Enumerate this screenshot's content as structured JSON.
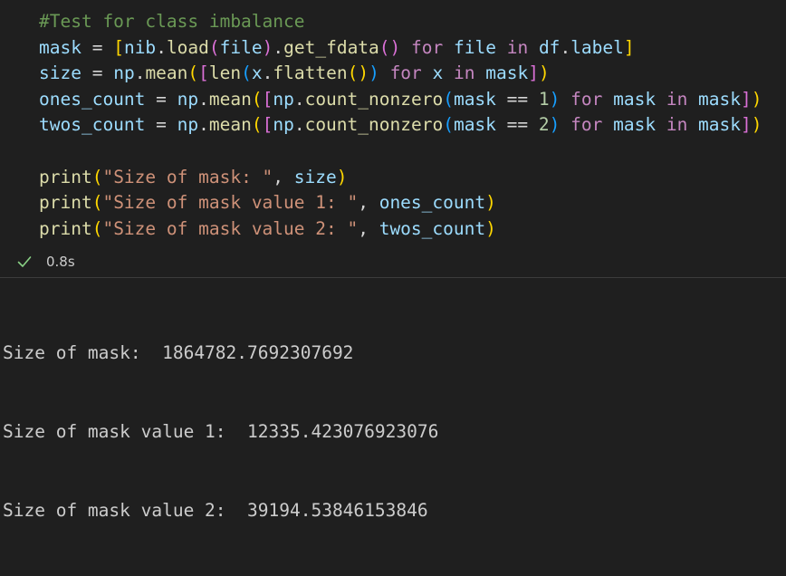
{
  "code_lines": [
    [
      {
        "t": "#Test for class imbalance",
        "c": "cm"
      }
    ],
    [
      {
        "t": "mask",
        "c": "v"
      },
      {
        "t": " = ",
        "c": "op"
      },
      {
        "t": "[",
        "c": "b1"
      },
      {
        "t": "nib",
        "c": "v"
      },
      {
        "t": ".",
        "c": "op"
      },
      {
        "t": "load",
        "c": "fn"
      },
      {
        "t": "(",
        "c": "b2"
      },
      {
        "t": "file",
        "c": "v"
      },
      {
        "t": ")",
        "c": "b2"
      },
      {
        "t": ".",
        "c": "op"
      },
      {
        "t": "get_fdata",
        "c": "fn"
      },
      {
        "t": "()",
        "c": "b2"
      },
      {
        "t": " ",
        "c": "op"
      },
      {
        "t": "for",
        "c": "kw"
      },
      {
        "t": " file ",
        "c": "v"
      },
      {
        "t": "in",
        "c": "kw"
      },
      {
        "t": " df",
        "c": "v"
      },
      {
        "t": ".",
        "c": "op"
      },
      {
        "t": "label",
        "c": "v"
      },
      {
        "t": "]",
        "c": "b1"
      }
    ],
    [
      {
        "t": "size",
        "c": "v"
      },
      {
        "t": " = ",
        "c": "op"
      },
      {
        "t": "np",
        "c": "v"
      },
      {
        "t": ".",
        "c": "op"
      },
      {
        "t": "mean",
        "c": "fn"
      },
      {
        "t": "(",
        "c": "b1"
      },
      {
        "t": "[",
        "c": "b2"
      },
      {
        "t": "len",
        "c": "fn"
      },
      {
        "t": "(",
        "c": "b3"
      },
      {
        "t": "x",
        "c": "v"
      },
      {
        "t": ".",
        "c": "op"
      },
      {
        "t": "flatten",
        "c": "fn"
      },
      {
        "t": "()",
        "c": "b1"
      },
      {
        "t": ")",
        "c": "b3"
      },
      {
        "t": " ",
        "c": "op"
      },
      {
        "t": "for",
        "c": "kw"
      },
      {
        "t": " x ",
        "c": "v"
      },
      {
        "t": "in",
        "c": "kw"
      },
      {
        "t": " mask",
        "c": "v"
      },
      {
        "t": "]",
        "c": "b2"
      },
      {
        "t": ")",
        "c": "b1"
      }
    ],
    [
      {
        "t": "ones_count",
        "c": "v"
      },
      {
        "t": " = ",
        "c": "op"
      },
      {
        "t": "np",
        "c": "v"
      },
      {
        "t": ".",
        "c": "op"
      },
      {
        "t": "mean",
        "c": "fn"
      },
      {
        "t": "(",
        "c": "b1"
      },
      {
        "t": "[",
        "c": "b2"
      },
      {
        "t": "np",
        "c": "v"
      },
      {
        "t": ".",
        "c": "op"
      },
      {
        "t": "count_nonzero",
        "c": "fn"
      },
      {
        "t": "(",
        "c": "b3"
      },
      {
        "t": "mask",
        "c": "v"
      },
      {
        "t": " == ",
        "c": "op"
      },
      {
        "t": "1",
        "c": "nu"
      },
      {
        "t": ")",
        "c": "b3"
      },
      {
        "t": " ",
        "c": "op"
      },
      {
        "t": "for",
        "c": "kw"
      },
      {
        "t": " mask ",
        "c": "v"
      },
      {
        "t": "in",
        "c": "kw"
      },
      {
        "t": " mask",
        "c": "v"
      },
      {
        "t": "]",
        "c": "b2"
      },
      {
        "t": ")",
        "c": "b1"
      }
    ],
    [
      {
        "t": "twos_count",
        "c": "v"
      },
      {
        "t": " = ",
        "c": "op"
      },
      {
        "t": "np",
        "c": "v"
      },
      {
        "t": ".",
        "c": "op"
      },
      {
        "t": "mean",
        "c": "fn"
      },
      {
        "t": "(",
        "c": "b1"
      },
      {
        "t": "[",
        "c": "b2"
      },
      {
        "t": "np",
        "c": "v"
      },
      {
        "t": ".",
        "c": "op"
      },
      {
        "t": "count_nonzero",
        "c": "fn"
      },
      {
        "t": "(",
        "c": "b3"
      },
      {
        "t": "mask",
        "c": "v"
      },
      {
        "t": " == ",
        "c": "op"
      },
      {
        "t": "2",
        "c": "nu"
      },
      {
        "t": ")",
        "c": "b3"
      },
      {
        "t": " ",
        "c": "op"
      },
      {
        "t": "for",
        "c": "kw"
      },
      {
        "t": " mask ",
        "c": "v"
      },
      {
        "t": "in",
        "c": "kw"
      },
      {
        "t": " mask",
        "c": "v"
      },
      {
        "t": "]",
        "c": "b2"
      },
      {
        "t": ")",
        "c": "b1"
      }
    ],
    [],
    [
      {
        "t": "print",
        "c": "fn"
      },
      {
        "t": "(",
        "c": "b1"
      },
      {
        "t": "\"Size of mask: \"",
        "c": "st"
      },
      {
        "t": ", ",
        "c": "op"
      },
      {
        "t": "size",
        "c": "v"
      },
      {
        "t": ")",
        "c": "b1"
      }
    ],
    [
      {
        "t": "print",
        "c": "fn"
      },
      {
        "t": "(",
        "c": "b1"
      },
      {
        "t": "\"Size of mask value 1: \"",
        "c": "st"
      },
      {
        "t": ", ",
        "c": "op"
      },
      {
        "t": "ones_count",
        "c": "v"
      },
      {
        "t": ")",
        "c": "b1"
      }
    ],
    [
      {
        "t": "print",
        "c": "fn"
      },
      {
        "t": "(",
        "c": "b1"
      },
      {
        "t": "\"Size of mask value 2: \"",
        "c": "st"
      },
      {
        "t": ", ",
        "c": "op"
      },
      {
        "t": "twos_count",
        "c": "v"
      },
      {
        "t": ")",
        "c": "b1"
      }
    ]
  ],
  "status": {
    "icon": "check-icon",
    "duration": "0.8s",
    "color": "#89d185"
  },
  "output_lines": [
    "Size of mask:  1864782.7692307692",
    "Size of mask value 1:  12335.423076923076",
    "Size of mask value 2:  39194.53846153846"
  ]
}
